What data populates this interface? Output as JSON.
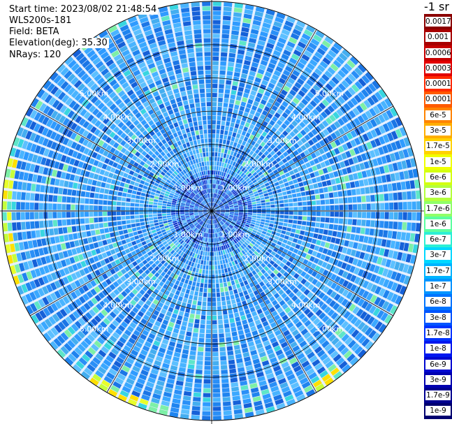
{
  "header": {
    "start_time": "Start time: 2023/08/02 21:48:54",
    "instrument": "WLS200s-181",
    "field": "Field: BETA",
    "elevation": "Elevation(deg): 35.30",
    "nrays": "NRays: 120"
  },
  "colorbar": {
    "unit": "-1 sr",
    "labels": [
      "0.0017",
      "0.001",
      "0.0006",
      "0.0003",
      "0.00017",
      "0.0001",
      "6e-5",
      "3e-5",
      "1.7e-5",
      "1e-5",
      "6e-6",
      "3e-6",
      "1.7e-6",
      "1e-6",
      "6e-7",
      "3e-7",
      "1.7e-7",
      "1e-7",
      "6e-8",
      "3e-8",
      "1.7e-8",
      "1e-8",
      "6e-9",
      "3e-9",
      "1.7e-9",
      "1e-9"
    ],
    "colors": [
      "#8b0000",
      "#a80000",
      "#c60000",
      "#e20000",
      "#ff2a00",
      "#ff5a00",
      "#ff8400",
      "#ffae00",
      "#ffd200",
      "#f0ff00",
      "#d4ff10",
      "#b4ff3c",
      "#90ff68",
      "#5cffa0",
      "#2cf0d4",
      "#00d8ff",
      "#00b4ff",
      "#0094ff",
      "#0074ff",
      "#0054ff",
      "#0034ff",
      "#0018f0",
      "#0008d0",
      "#0000b0",
      "#000090",
      "#000070"
    ]
  },
  "chart_data": {
    "type": "polar-ppi",
    "n_rays": 120,
    "range_rings_km": [
      1.0,
      2.0,
      3.0,
      4.0,
      5.0
    ],
    "range_labels": [
      "1.00km",
      "2.00km",
      "3.00km",
      "4.00km",
      "5.00km"
    ],
    "max_range_km": 6.3,
    "dominant_level": "1e-7 to 6e-8 (light/medium blue)",
    "near_center_level": "1.7e-8 to 1e-8 (darker blue)",
    "edge_highlights": "yellow/green patches (about 1e-5 to 1e-6) at west and south-southwest rim",
    "azimuth_lines_deg": [
      0,
      30,
      60,
      90,
      120,
      150,
      180,
      210,
      240,
      270,
      300,
      330
    ],
    "grid": true
  }
}
